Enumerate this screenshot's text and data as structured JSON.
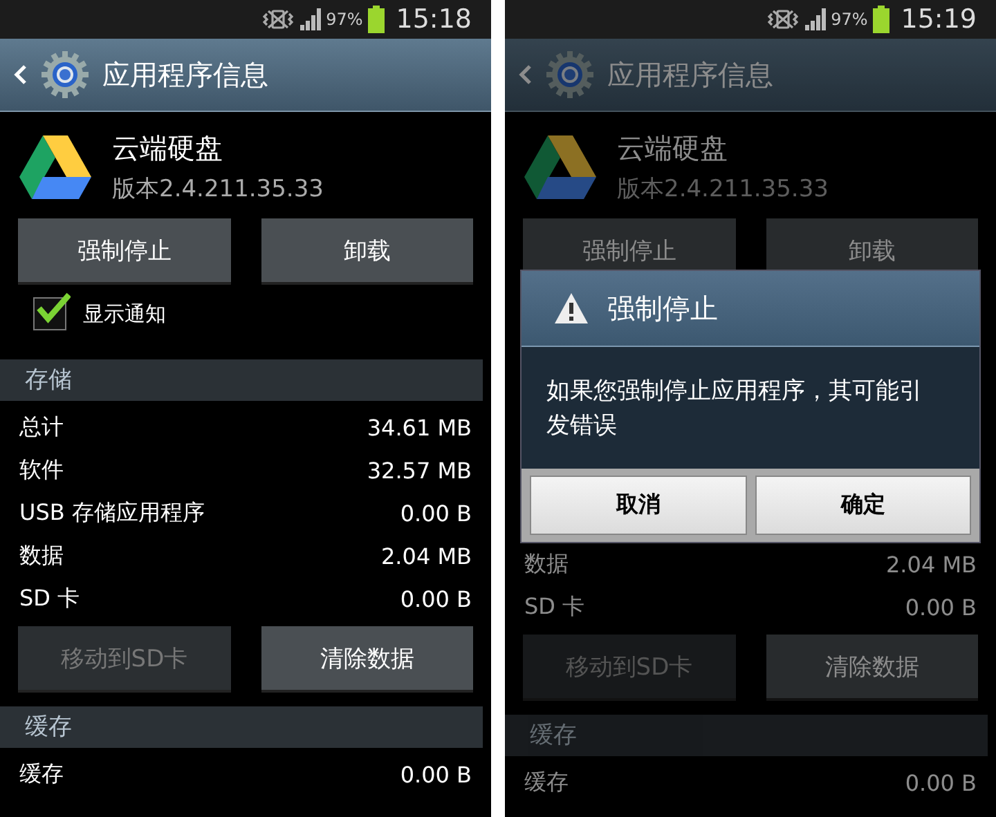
{
  "screens": [
    {
      "dimmed": false,
      "status_bar": {
        "battery": "97%",
        "time": "15:18"
      },
      "header": {
        "title": "应用程序信息"
      },
      "app": {
        "name": "云端硬盘",
        "version": "版本2.4.211.35.33"
      },
      "actions": [
        {
          "label": "强制停止",
          "disabled": false
        },
        {
          "label": "卸载",
          "disabled": false
        }
      ],
      "notification_toggle": {
        "label": "显示通知",
        "checked": true
      },
      "items": [
        {
          "kind": "section",
          "label": "存储"
        },
        {
          "kind": "row",
          "label": "总计",
          "value": "34.61 MB"
        },
        {
          "kind": "row",
          "label": "软件",
          "value": "32.57 MB"
        },
        {
          "kind": "row",
          "label": "USB 存储应用程序",
          "value": "0.00 B"
        },
        {
          "kind": "row",
          "label": "数据",
          "value": "2.04 MB"
        },
        {
          "kind": "row",
          "label": "SD 卡",
          "value": "0.00 B"
        },
        {
          "kind": "buttons",
          "buttons": [
            {
              "label": "移动到SD卡",
              "disabled": true
            },
            {
              "label": "清除数据",
              "disabled": false
            }
          ]
        },
        {
          "kind": "section",
          "label": "缓存"
        },
        {
          "kind": "row",
          "label": "缓存",
          "value": "0.00 B"
        }
      ]
    },
    {
      "dimmed": true,
      "status_bar": {
        "battery": "97%",
        "time": "15:19"
      },
      "header": {
        "title": "应用程序信息"
      },
      "app": {
        "name": "云端硬盘",
        "version": "版本2.4.211.35.33"
      },
      "actions": [
        {
          "label": "强制停止",
          "disabled": false
        },
        {
          "label": "卸载",
          "disabled": false
        }
      ],
      "dialog": {
        "title": "强制停止",
        "message": "如果您强制停止应用程序，其可能引发错误",
        "buttons": [
          "取消",
          "确定"
        ]
      },
      "items": [
        {
          "kind": "row",
          "label": "数据",
          "value": "2.04 MB"
        },
        {
          "kind": "row",
          "label": "SD 卡",
          "value": "0.00 B"
        },
        {
          "kind": "buttons",
          "buttons": [
            {
              "label": "移动到SD卡",
              "disabled": true
            },
            {
              "label": "清除数据",
              "disabled": false
            }
          ]
        },
        {
          "kind": "section",
          "label": "缓存"
        },
        {
          "kind": "row",
          "label": "缓存",
          "value": "0.00 B"
        }
      ]
    }
  ]
}
